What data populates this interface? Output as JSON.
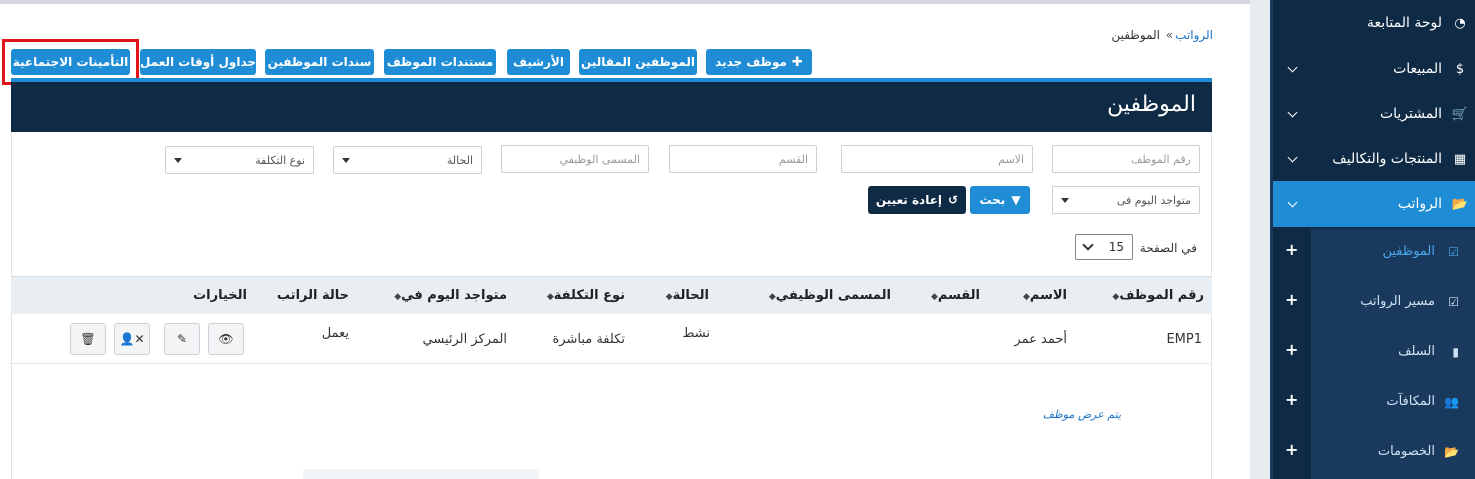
{
  "breadcrumb": {
    "parent": "الرواتب",
    "separator": "»",
    "current": "الموظفين"
  },
  "top_buttons": {
    "new_employee": "موظف جديد",
    "contract_employees": "الموظفين المقالين",
    "archive": "الأرشيف",
    "employee_documents": "مستندات الموظف",
    "employee_bonds": "سندات الموظفين",
    "work_schedules": "جداول أوقات العمل",
    "social_insurance": "التأمينات الاجتماعية"
  },
  "card": {
    "title": "الموظفين"
  },
  "filters": {
    "employee_code_placeholder": "رقم الموظف",
    "name_placeholder": "الاسم",
    "department_placeholder": "القسم",
    "job_title_placeholder": "المسمى الوظيفي",
    "status_select": "الحالة",
    "cost_type_select": "نوع التكلفة",
    "present_today_select": "متواجد اليوم فى",
    "search_label": "بحث",
    "reset_label": "إعادة تعيين"
  },
  "pagination": {
    "per_page_label": "في الصفحة",
    "per_page_value": "15"
  },
  "table": {
    "headers": {
      "code": "رقم الموظف",
      "name": "الاسم",
      "department": "القسم",
      "job_title": "المسمى الوظيفي",
      "status": "الحالة",
      "cost_type": "نوع التكلفة",
      "present_today": "متواجد اليوم في",
      "salary_status": "حالة الراتب",
      "options": "الخيارات"
    },
    "rows": [
      {
        "code": "EMP1",
        "name": "أحمد عمر",
        "department": "",
        "job_title": "",
        "status": "نشط",
        "cost_type": "تكلفة مباشرة",
        "present_today": "المركز الرئيسي",
        "salary_status": "يعمل"
      }
    ],
    "footnote": "يتم عرض موظف"
  },
  "sidebar": {
    "items": [
      {
        "label": "لوحة المتابعة",
        "icon": "dashboard-icon"
      },
      {
        "label": "المبيعات",
        "icon": "dollar-icon"
      },
      {
        "label": "المشتريات",
        "icon": "cart-icon"
      },
      {
        "label": "المنتجات والتكاليف",
        "icon": "grid-icon"
      },
      {
        "label": "الرواتب",
        "icon": "folder-open-icon"
      }
    ],
    "sub_items": [
      {
        "label": "الموظفين",
        "icon": "calendar-check-icon"
      },
      {
        "label": "مسير الرواتب",
        "icon": "calendar-check-icon"
      },
      {
        "label": "السلف",
        "icon": "book-icon"
      },
      {
        "label": "المكافآت",
        "icon": "users-icon"
      },
      {
        "label": "الخصومات",
        "icon": "folder-open-icon"
      }
    ]
  },
  "colors": {
    "primary": "#1f8dd6",
    "dark": "#0f2a44",
    "highlight": "#e0161c",
    "link": "#1a73c6"
  }
}
